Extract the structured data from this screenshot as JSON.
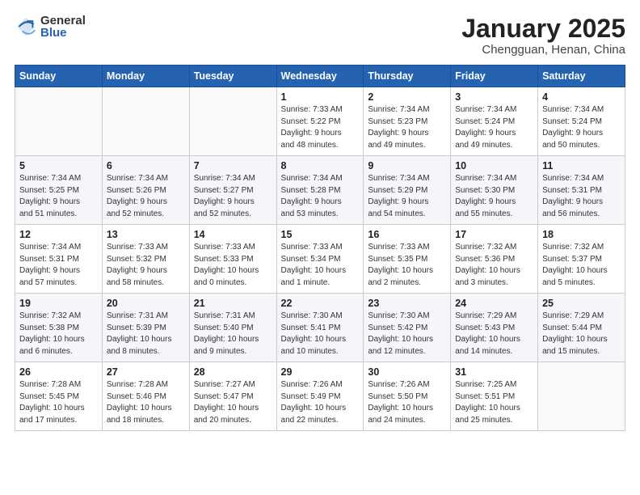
{
  "header": {
    "logo_general": "General",
    "logo_blue": "Blue",
    "month_title": "January 2025",
    "location": "Chengguan, Henan, China"
  },
  "days_of_week": [
    "Sunday",
    "Monday",
    "Tuesday",
    "Wednesday",
    "Thursday",
    "Friday",
    "Saturday"
  ],
  "weeks": [
    [
      {
        "day": "",
        "info": ""
      },
      {
        "day": "",
        "info": ""
      },
      {
        "day": "",
        "info": ""
      },
      {
        "day": "1",
        "info": "Sunrise: 7:33 AM\nSunset: 5:22 PM\nDaylight: 9 hours\nand 48 minutes."
      },
      {
        "day": "2",
        "info": "Sunrise: 7:34 AM\nSunset: 5:23 PM\nDaylight: 9 hours\nand 49 minutes."
      },
      {
        "day": "3",
        "info": "Sunrise: 7:34 AM\nSunset: 5:24 PM\nDaylight: 9 hours\nand 49 minutes."
      },
      {
        "day": "4",
        "info": "Sunrise: 7:34 AM\nSunset: 5:24 PM\nDaylight: 9 hours\nand 50 minutes."
      }
    ],
    [
      {
        "day": "5",
        "info": "Sunrise: 7:34 AM\nSunset: 5:25 PM\nDaylight: 9 hours\nand 51 minutes."
      },
      {
        "day": "6",
        "info": "Sunrise: 7:34 AM\nSunset: 5:26 PM\nDaylight: 9 hours\nand 52 minutes."
      },
      {
        "day": "7",
        "info": "Sunrise: 7:34 AM\nSunset: 5:27 PM\nDaylight: 9 hours\nand 52 minutes."
      },
      {
        "day": "8",
        "info": "Sunrise: 7:34 AM\nSunset: 5:28 PM\nDaylight: 9 hours\nand 53 minutes."
      },
      {
        "day": "9",
        "info": "Sunrise: 7:34 AM\nSunset: 5:29 PM\nDaylight: 9 hours\nand 54 minutes."
      },
      {
        "day": "10",
        "info": "Sunrise: 7:34 AM\nSunset: 5:30 PM\nDaylight: 9 hours\nand 55 minutes."
      },
      {
        "day": "11",
        "info": "Sunrise: 7:34 AM\nSunset: 5:31 PM\nDaylight: 9 hours\nand 56 minutes."
      }
    ],
    [
      {
        "day": "12",
        "info": "Sunrise: 7:34 AM\nSunset: 5:31 PM\nDaylight: 9 hours\nand 57 minutes."
      },
      {
        "day": "13",
        "info": "Sunrise: 7:33 AM\nSunset: 5:32 PM\nDaylight: 9 hours\nand 58 minutes."
      },
      {
        "day": "14",
        "info": "Sunrise: 7:33 AM\nSunset: 5:33 PM\nDaylight: 10 hours\nand 0 minutes."
      },
      {
        "day": "15",
        "info": "Sunrise: 7:33 AM\nSunset: 5:34 PM\nDaylight: 10 hours\nand 1 minute."
      },
      {
        "day": "16",
        "info": "Sunrise: 7:33 AM\nSunset: 5:35 PM\nDaylight: 10 hours\nand 2 minutes."
      },
      {
        "day": "17",
        "info": "Sunrise: 7:32 AM\nSunset: 5:36 PM\nDaylight: 10 hours\nand 3 minutes."
      },
      {
        "day": "18",
        "info": "Sunrise: 7:32 AM\nSunset: 5:37 PM\nDaylight: 10 hours\nand 5 minutes."
      }
    ],
    [
      {
        "day": "19",
        "info": "Sunrise: 7:32 AM\nSunset: 5:38 PM\nDaylight: 10 hours\nand 6 minutes."
      },
      {
        "day": "20",
        "info": "Sunrise: 7:31 AM\nSunset: 5:39 PM\nDaylight: 10 hours\nand 8 minutes."
      },
      {
        "day": "21",
        "info": "Sunrise: 7:31 AM\nSunset: 5:40 PM\nDaylight: 10 hours\nand 9 minutes."
      },
      {
        "day": "22",
        "info": "Sunrise: 7:30 AM\nSunset: 5:41 PM\nDaylight: 10 hours\nand 10 minutes."
      },
      {
        "day": "23",
        "info": "Sunrise: 7:30 AM\nSunset: 5:42 PM\nDaylight: 10 hours\nand 12 minutes."
      },
      {
        "day": "24",
        "info": "Sunrise: 7:29 AM\nSunset: 5:43 PM\nDaylight: 10 hours\nand 14 minutes."
      },
      {
        "day": "25",
        "info": "Sunrise: 7:29 AM\nSunset: 5:44 PM\nDaylight: 10 hours\nand 15 minutes."
      }
    ],
    [
      {
        "day": "26",
        "info": "Sunrise: 7:28 AM\nSunset: 5:45 PM\nDaylight: 10 hours\nand 17 minutes."
      },
      {
        "day": "27",
        "info": "Sunrise: 7:28 AM\nSunset: 5:46 PM\nDaylight: 10 hours\nand 18 minutes."
      },
      {
        "day": "28",
        "info": "Sunrise: 7:27 AM\nSunset: 5:47 PM\nDaylight: 10 hours\nand 20 minutes."
      },
      {
        "day": "29",
        "info": "Sunrise: 7:26 AM\nSunset: 5:49 PM\nDaylight: 10 hours\nand 22 minutes."
      },
      {
        "day": "30",
        "info": "Sunrise: 7:26 AM\nSunset: 5:50 PM\nDaylight: 10 hours\nand 24 minutes."
      },
      {
        "day": "31",
        "info": "Sunrise: 7:25 AM\nSunset: 5:51 PM\nDaylight: 10 hours\nand 25 minutes."
      },
      {
        "day": "",
        "info": ""
      }
    ]
  ]
}
